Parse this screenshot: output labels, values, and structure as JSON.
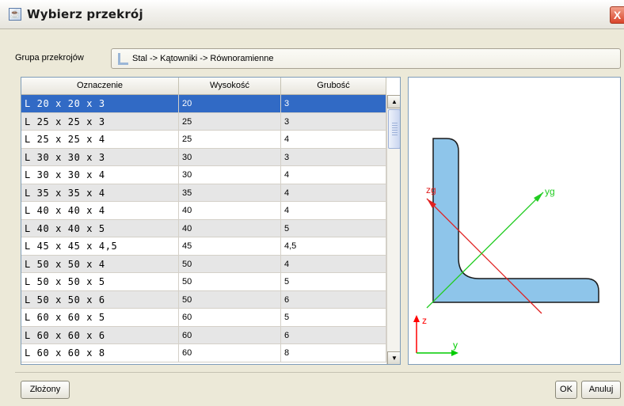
{
  "window": {
    "title": "Wybierz przekrój",
    "close_glyph": "X"
  },
  "group": {
    "label": "Grupa przekrojów",
    "path": "Stal -> Kątowniki -> Równoramienne",
    "icon": "folder-icon"
  },
  "table": {
    "columns": [
      "Oznaczenie",
      "Wysokość",
      "Grubość"
    ],
    "selected_index": 0,
    "rows": [
      [
        "L 20 x 20 x 3",
        "20",
        "3"
      ],
      [
        "L 25 x 25 x 3",
        "25",
        "3"
      ],
      [
        "L 25 x 25 x 4",
        "25",
        "4"
      ],
      [
        "L 30 x 30 x 3",
        "30",
        "3"
      ],
      [
        "L 30 x 30 x 4",
        "30",
        "4"
      ],
      [
        "L 35 x 35 x 4",
        "35",
        "4"
      ],
      [
        "L 40 x 40 x 4",
        "40",
        "4"
      ],
      [
        "L 40 x 40 x 5",
        "40",
        "5"
      ],
      [
        "L 45 x 45 x 4,5",
        "45",
        "4,5"
      ],
      [
        "L 50 x 50 x 4",
        "50",
        "4"
      ],
      [
        "L 50 x 50 x 5",
        "50",
        "5"
      ],
      [
        "L 50 x 50 x 6",
        "50",
        "6"
      ],
      [
        "L 60 x 60 x 5",
        "60",
        "5"
      ],
      [
        "L 60 x 60 x 6",
        "60",
        "6"
      ],
      [
        "L 60 x 60 x 8",
        "60",
        "8"
      ]
    ]
  },
  "preview": {
    "labels": {
      "zg": "zg",
      "yg": "yg",
      "z": "z",
      "y": "y"
    },
    "colors": {
      "fill": "#8ec5ea",
      "outline": "#1a1a1a",
      "zg_axis": "#e02020",
      "yg_axis": "#22cc22",
      "z_axis": "#ff0000",
      "y_axis": "#00cc00"
    }
  },
  "buttons": {
    "compound": "Złożony",
    "ok": "OK",
    "cancel": "Anuluj"
  },
  "colors": {
    "selection": "#316ac5",
    "window_bg": "#ece9d8"
  }
}
